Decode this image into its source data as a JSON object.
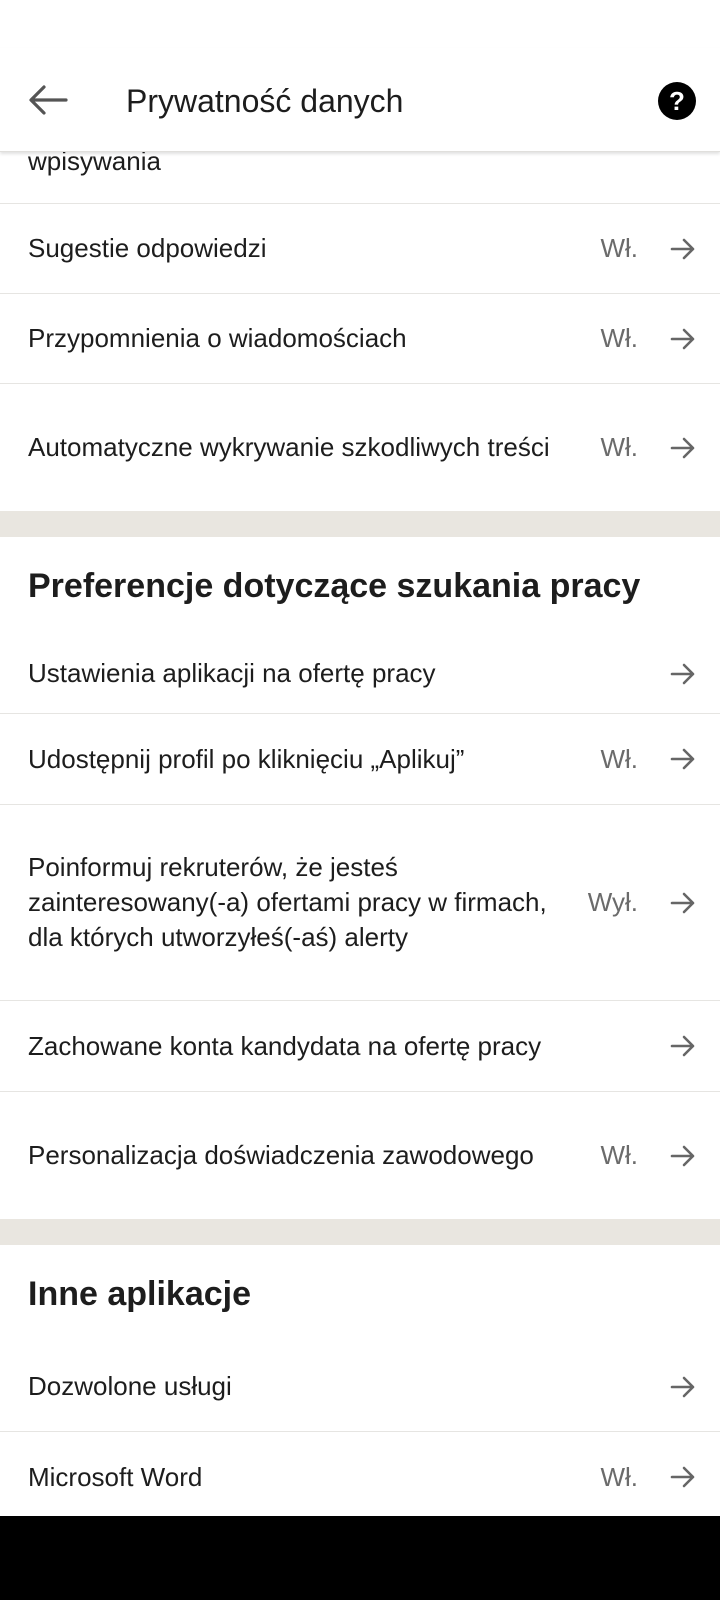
{
  "header": {
    "title": "Prywatność danych",
    "back_icon": "arrow-left-icon",
    "help_icon": "question-circle-icon",
    "help_glyph": "?"
  },
  "partial_item": {
    "label": "wpisywania"
  },
  "top_items": [
    {
      "label": "Sugestie odpowiedzi",
      "status": "Wł."
    },
    {
      "label": "Przypomnienia o wiadomościach",
      "status": "Wł."
    },
    {
      "label": "Automatyczne wykrywanie szkodliwych treści",
      "status": "Wł."
    }
  ],
  "job_section": {
    "title": "Preferencje dotyczące szukania pracy",
    "items": [
      {
        "label": "Ustawienia aplikacji na ofertę pracy",
        "status": ""
      },
      {
        "label": "Udostępnij profil po kliknięciu „Aplikuj”",
        "status": "Wł."
      },
      {
        "label": "Poinformuj rekruterów, że jesteś zainteresowany(-a) ofertami pracy w firmach, dla których utworzyłeś(-aś) alerty",
        "status": "Wył."
      },
      {
        "label": "Zachowane konta kandydata na ofertę pracy",
        "status": ""
      },
      {
        "label": "Personalizacja doświadczenia zawodowego",
        "status": "Wł."
      }
    ]
  },
  "other_section": {
    "title": "Inne aplikacje",
    "items": [
      {
        "label": "Dozwolone usługi",
        "status": ""
      },
      {
        "label": "Microsoft Word",
        "status": "Wł."
      }
    ]
  },
  "colors": {
    "text": "#1d1d1d",
    "status": "#6b6b6b",
    "arrow": "#666666",
    "divider": "#e6e5e2",
    "section_gap": "#e9e6e0"
  }
}
